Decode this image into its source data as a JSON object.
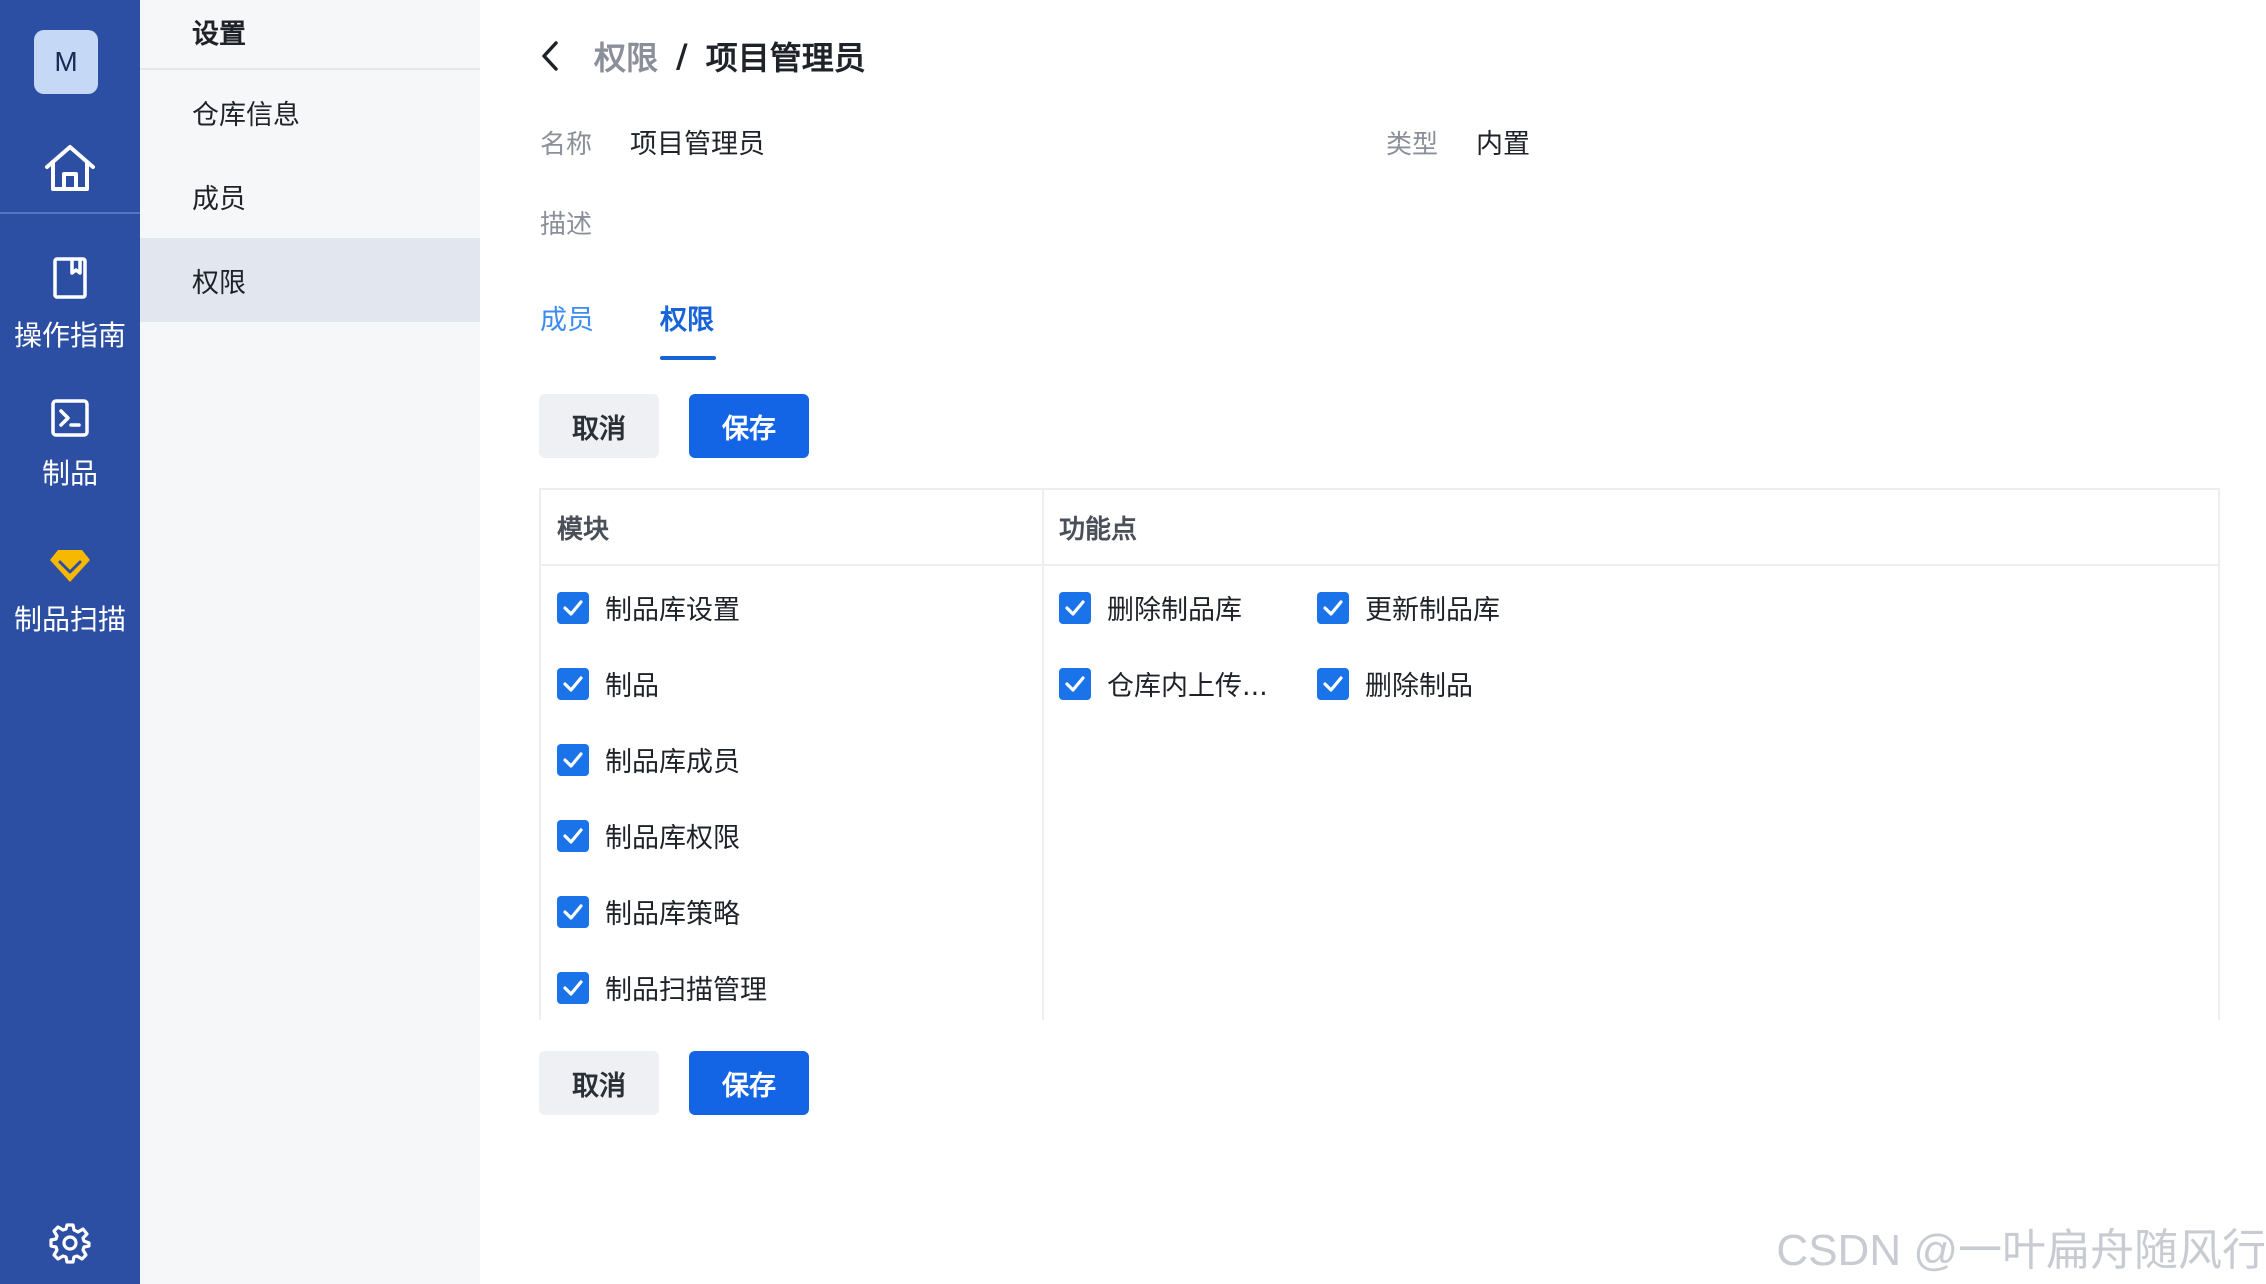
{
  "rail": {
    "avatar": "M",
    "items": [
      {
        "label": "操作指南",
        "icon": "bookmark-icon"
      },
      {
        "label": "制品",
        "icon": "terminal-icon"
      },
      {
        "label": "制品扫描",
        "icon": "diamond-icon"
      }
    ],
    "colors": {
      "background": "#2d4fa3",
      "diamond": "#f6b900"
    }
  },
  "submenu": {
    "title": "设置",
    "items": [
      "仓库信息",
      "成员",
      "权限"
    ],
    "active": "权限"
  },
  "breadcrumb": {
    "parent": "权限",
    "separator": "/",
    "current": "项目管理员"
  },
  "info": {
    "name_label": "名称",
    "name_value": "项目管理员",
    "type_label": "类型",
    "type_value": "内置",
    "desc_label": "描述"
  },
  "tabs": {
    "members": "成员",
    "permissions": "权限",
    "active": "权限"
  },
  "actions": {
    "cancel": "取消",
    "save": "保存"
  },
  "table": {
    "headers": {
      "module": "模块",
      "features": "功能点"
    },
    "modules": [
      {
        "label": "制品库设置",
        "checked": true
      },
      {
        "label": "制品",
        "checked": true
      },
      {
        "label": "制品库成员",
        "checked": true
      },
      {
        "label": "制品库权限",
        "checked": true
      },
      {
        "label": "制品库策略",
        "checked": true
      },
      {
        "label": "制品扫描管理",
        "checked": true
      }
    ],
    "features": [
      {
        "label": "删除制品库",
        "checked": true
      },
      {
        "label": "更新制品库",
        "checked": true
      },
      {
        "label": "仓库内上传...",
        "checked": true
      },
      {
        "label": "删除制品",
        "checked": true
      }
    ]
  },
  "watermark": "CSDN @一叶扁舟随风行",
  "accent": "#1464e6"
}
